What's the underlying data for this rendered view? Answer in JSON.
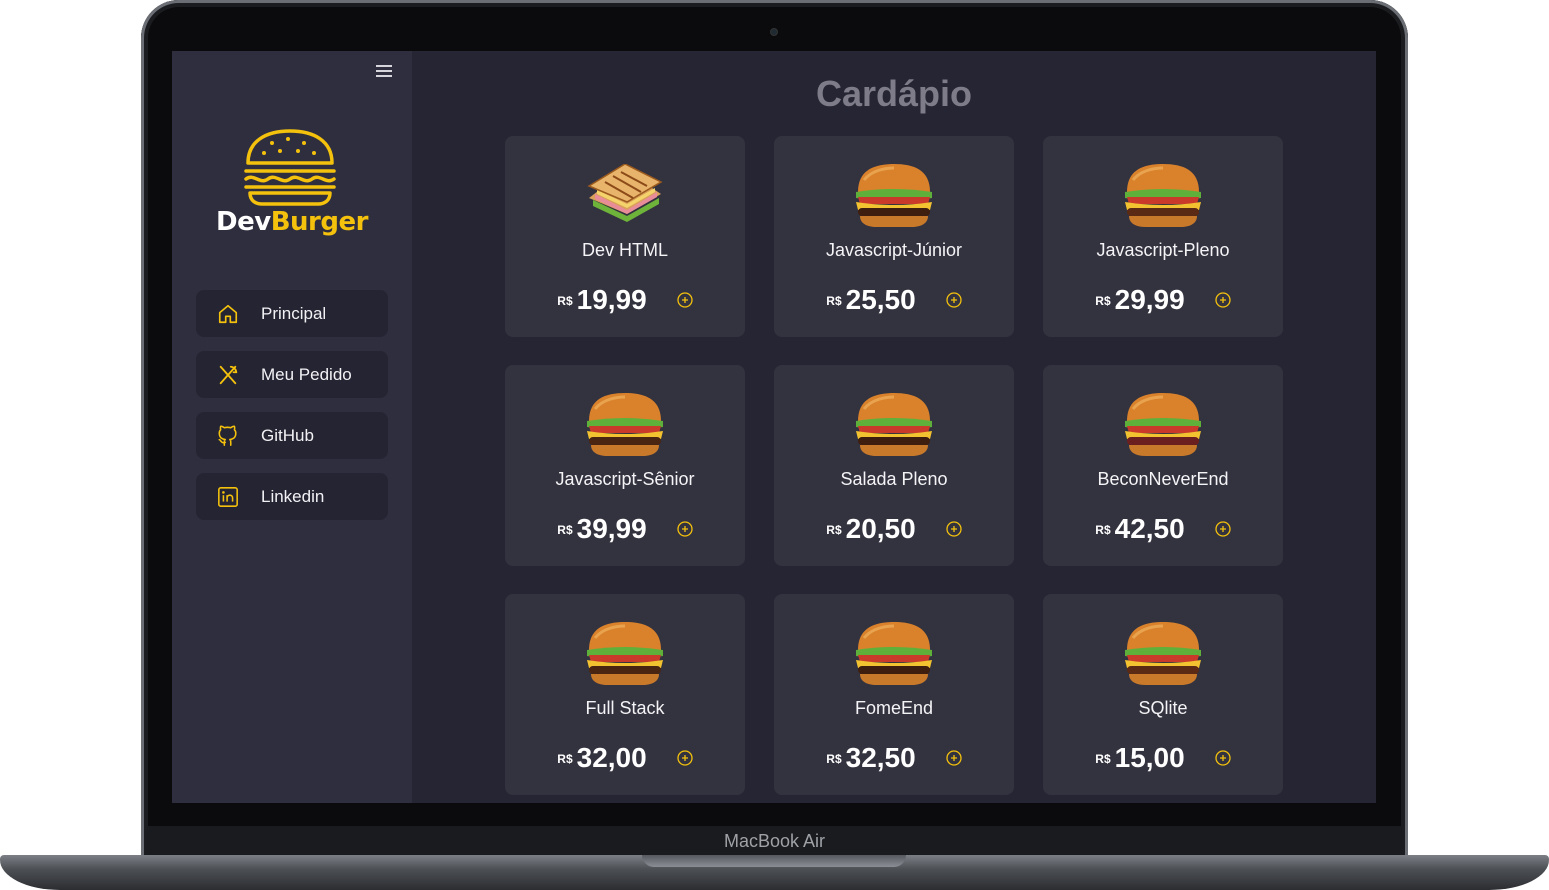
{
  "device": {
    "label": "MacBook Air"
  },
  "app": {
    "brand": {
      "first": "Dev",
      "second": "Burger"
    },
    "page_title": "Cardápio",
    "colors": {
      "accent": "#f4c20d",
      "background": "#262533",
      "sidebar": "#2f2e3e",
      "card": "#33323f"
    }
  },
  "sidebar": {
    "items": [
      {
        "label": "Principal",
        "icon": "home-icon"
      },
      {
        "label": "Meu Pedido",
        "icon": "utensils-icon"
      },
      {
        "label": "GitHub",
        "icon": "github-icon"
      },
      {
        "label": "Linkedin",
        "icon": "linkedin-icon"
      }
    ]
  },
  "menu": {
    "currency": "R$",
    "items": [
      {
        "name": "Dev HTML",
        "price": "19,99",
        "image": "sandwich"
      },
      {
        "name": "Javascript-Júnior",
        "price": "25,50",
        "image": "burger"
      },
      {
        "name": "Javascript-Pleno",
        "price": "29,99",
        "image": "burger"
      },
      {
        "name": "Javascript-Sênior",
        "price": "39,99",
        "image": "burger"
      },
      {
        "name": "Salada Pleno",
        "price": "20,50",
        "image": "burger"
      },
      {
        "name": "BeconNeverEnd",
        "price": "42,50",
        "image": "burger"
      },
      {
        "name": "Full Stack",
        "price": "32,00",
        "image": "burger"
      },
      {
        "name": "FomeEnd",
        "price": "32,50",
        "image": "burger"
      },
      {
        "name": "SQlite",
        "price": "15,00",
        "image": "burger"
      }
    ]
  }
}
